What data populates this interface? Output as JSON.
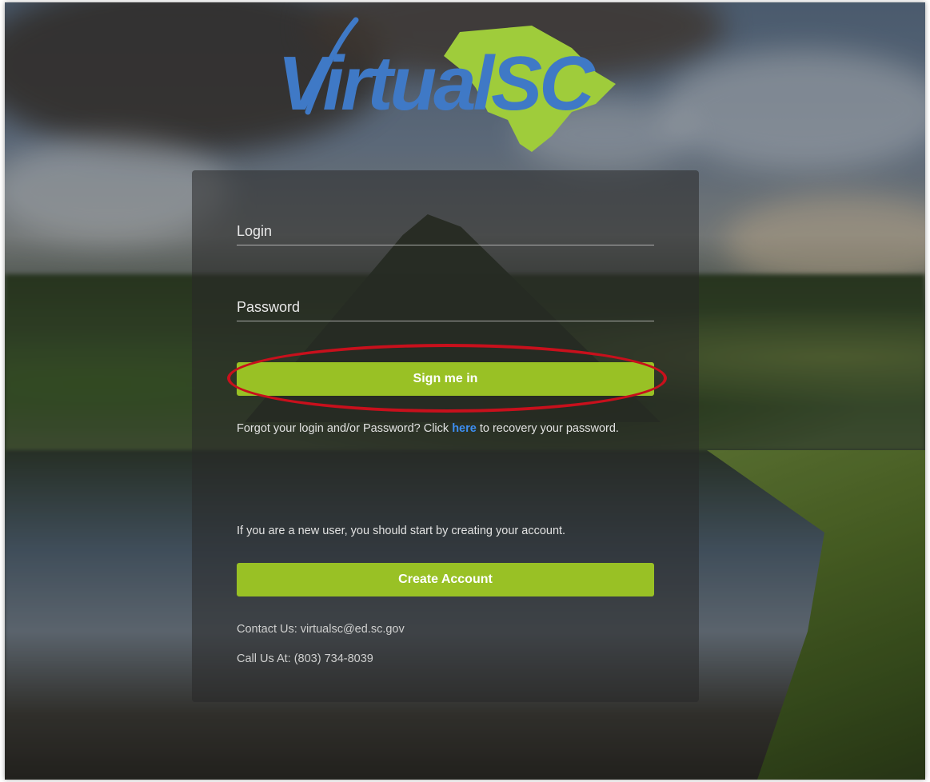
{
  "logo": {
    "text": "VirtualSC",
    "alt": "VirtualSC logo",
    "colors": {
      "text": "#3f79c6",
      "state": "#9fcc3b"
    }
  },
  "form": {
    "login_placeholder": "Login",
    "password_placeholder": "Password",
    "signin_label": "Sign me in",
    "forgot_prefix": "Forgot your login and/or Password? Click ",
    "forgot_link": "here",
    "forgot_suffix": " to recovery your password.",
    "new_user_text": "If you are a new user, you should start by creating your account.",
    "create_account_label": "Create Account",
    "contact": "Contact Us: virtualsc@ed.sc.gov",
    "phone": "Call Us At: (803) 734-8039"
  },
  "colors": {
    "accent": "#99c125",
    "link": "#3d8df0",
    "annotation": "#c8101c"
  }
}
